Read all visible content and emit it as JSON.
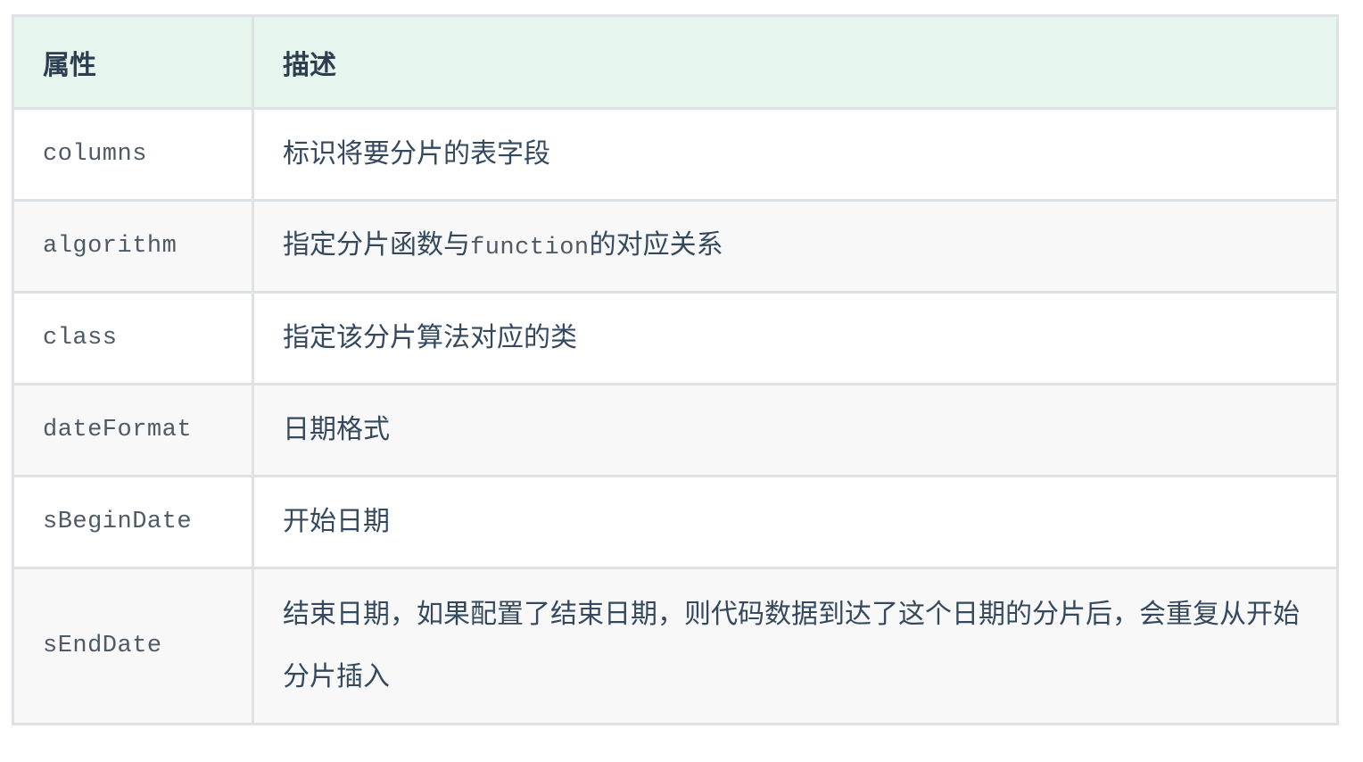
{
  "table": {
    "headers": [
      "属性",
      "描述"
    ],
    "rows": [
      {
        "name": "columns",
        "desc_before": "标识将要分片的表字段",
        "desc_code": "",
        "desc_after": ""
      },
      {
        "name": "algorithm",
        "desc_before": "指定分片函数与",
        "desc_code": "function",
        "desc_after": "的对应关系"
      },
      {
        "name": "class",
        "desc_before": "指定该分片算法对应的类",
        "desc_code": "",
        "desc_after": ""
      },
      {
        "name": "dateFormat",
        "desc_before": "日期格式",
        "desc_code": "",
        "desc_after": ""
      },
      {
        "name": "sBeginDate",
        "desc_before": "开始日期",
        "desc_code": "",
        "desc_after": ""
      },
      {
        "name": "sEndDate",
        "desc_before": "结束日期，如果配置了结束日期，则代码数据到达了这个日期的分片后，会重复从开始分片插入",
        "desc_code": "",
        "desc_after": ""
      }
    ]
  },
  "colors": {
    "header_bg": "#e6f6ee",
    "border": "#dfe2e5",
    "row_alt_bg": "#f8f8f8",
    "text": "#34495e"
  }
}
